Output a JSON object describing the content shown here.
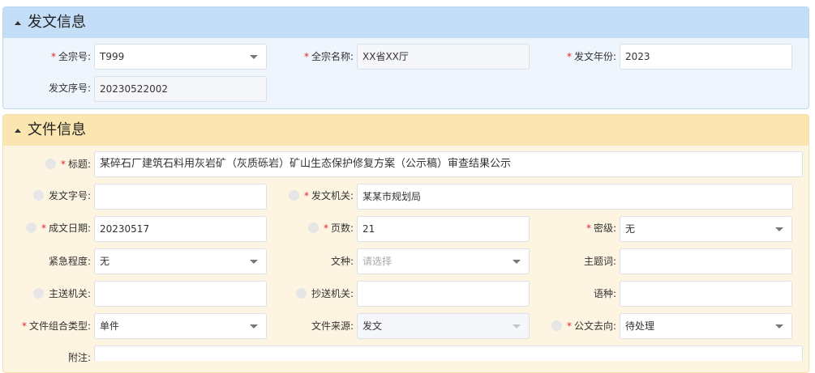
{
  "sections": {
    "issue_info": {
      "title": "发文信息",
      "fonds_code": {
        "label": "全宗号:",
        "value": "T999"
      },
      "fonds_name": {
        "label": "全宗名称:",
        "value": "XX省XX厅"
      },
      "issue_year": {
        "label": "发文年份:",
        "value": "2023"
      },
      "issue_serial": {
        "label": "发文序号:",
        "value": "20230522002"
      }
    },
    "file_info": {
      "title": "文件信息",
      "title_field": {
        "label": "标题:",
        "value": "某碎石厂建筑石料用灰岩矿（灰质砾岩）矿山生态保护修复方案（公示稿）审查结果公示"
      },
      "doc_number": {
        "label": "发文字号:",
        "value": ""
      },
      "issuing_org": {
        "label": "发文机关:",
        "value": "某某市规划局"
      },
      "created_date": {
        "label": "成文日期:",
        "value": "20230517"
      },
      "pages": {
        "label": "页数:",
        "value": "21"
      },
      "secrecy": {
        "label": "密级:",
        "value": "无"
      },
      "urgency": {
        "label": "紧急程度:",
        "value": "无"
      },
      "doc_type": {
        "label": "文种:",
        "placeholder": "请选择"
      },
      "keywords": {
        "label": "主题词:",
        "value": ""
      },
      "main_recipient": {
        "label": "主送机关:",
        "value": ""
      },
      "cc_recipient": {
        "label": "抄送机关:",
        "value": ""
      },
      "language": {
        "label": "语种:",
        "value": ""
      },
      "combo_type": {
        "label": "文件组合类型:",
        "value": "单件"
      },
      "source": {
        "label": "文件来源:",
        "value": "发文"
      },
      "direction": {
        "label": "公文去向:",
        "value": "待处理"
      },
      "attachment": {
        "label": "附注:",
        "value": ""
      }
    }
  }
}
